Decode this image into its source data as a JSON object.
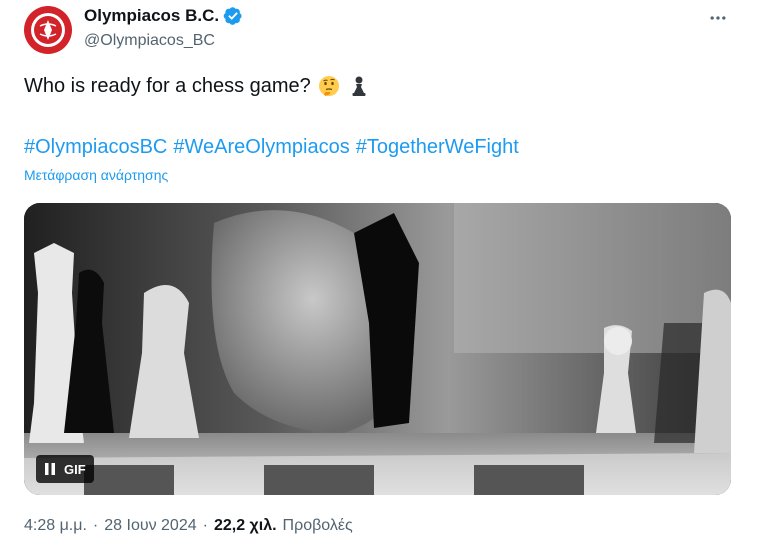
{
  "author": {
    "display_name": "Olympiacos B.C.",
    "handle": "@Olympiacos_BC",
    "avatar_icon": "olympiacos-crest-icon",
    "verified_icon": "verified-badge-icon",
    "brand_color": "#d2232a",
    "verified_color": "#1d9bf0"
  },
  "more_icon": "more-horizontal-icon",
  "tweet": {
    "text": "Who is ready for a chess game?",
    "emojis": [
      "thinking-face-emoji",
      "chess-pawn-emoji"
    ],
    "hashtags": [
      "#OlympiacosBC",
      "#WeAreOlympiacos",
      "#TogetherWeFight"
    ],
    "translate_label": "Μετάφραση ανάρτησης"
  },
  "media": {
    "type": "gif",
    "badge_label": "GIF",
    "pause_icon": "pause-icon",
    "description_icon": "chess-board-image"
  },
  "meta": {
    "time": "4:28 μ.μ.",
    "separator": "·",
    "date": "28 Ιουν 2024",
    "views_count": "22,2 χιλ.",
    "views_label": "Προβολές"
  },
  "colors": {
    "link": "#1d9bf0",
    "secondary_text": "#536471",
    "primary_text": "#0f1419"
  }
}
